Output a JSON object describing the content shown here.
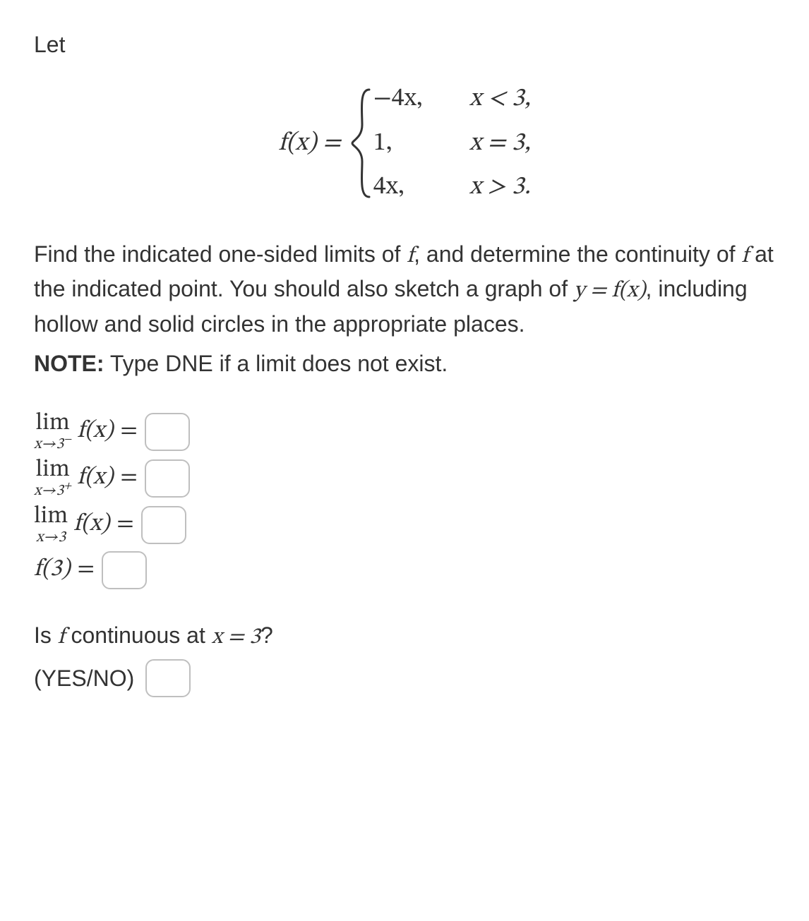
{
  "intro": "Let",
  "function": {
    "lhs": "f(x) = ",
    "cases": [
      {
        "expr": "−4x,",
        "cond": "x < 3,"
      },
      {
        "expr": "1,",
        "cond": "x = 3,"
      },
      {
        "expr": "4x,",
        "cond": "x > 3."
      }
    ]
  },
  "instructions": {
    "part1": "Find the indicated one-sided limits of ",
    "f1": "f",
    "part2": ", and determine the continuity of ",
    "f2": "f",
    "part3": " at the indicated point. You should also sketch a graph of ",
    "eq": "y = f(x)",
    "part4": ", including hollow and solid circles in the appropriate places."
  },
  "note": {
    "label": "NOTE:",
    "text": " Type DNE if a limit does not exist."
  },
  "answers": {
    "lim_word": "lim",
    "arrow": "x→3",
    "minus": "−",
    "plus": "+",
    "func": "f(x)",
    "eq": "=",
    "f_at_3": "f(3)"
  },
  "continuity": {
    "question_pre": "Is ",
    "f": "f",
    "question_mid": " continuous at ",
    "xeq": "x = 3",
    "question_post": "?",
    "yesno": "(YES/NO)"
  }
}
